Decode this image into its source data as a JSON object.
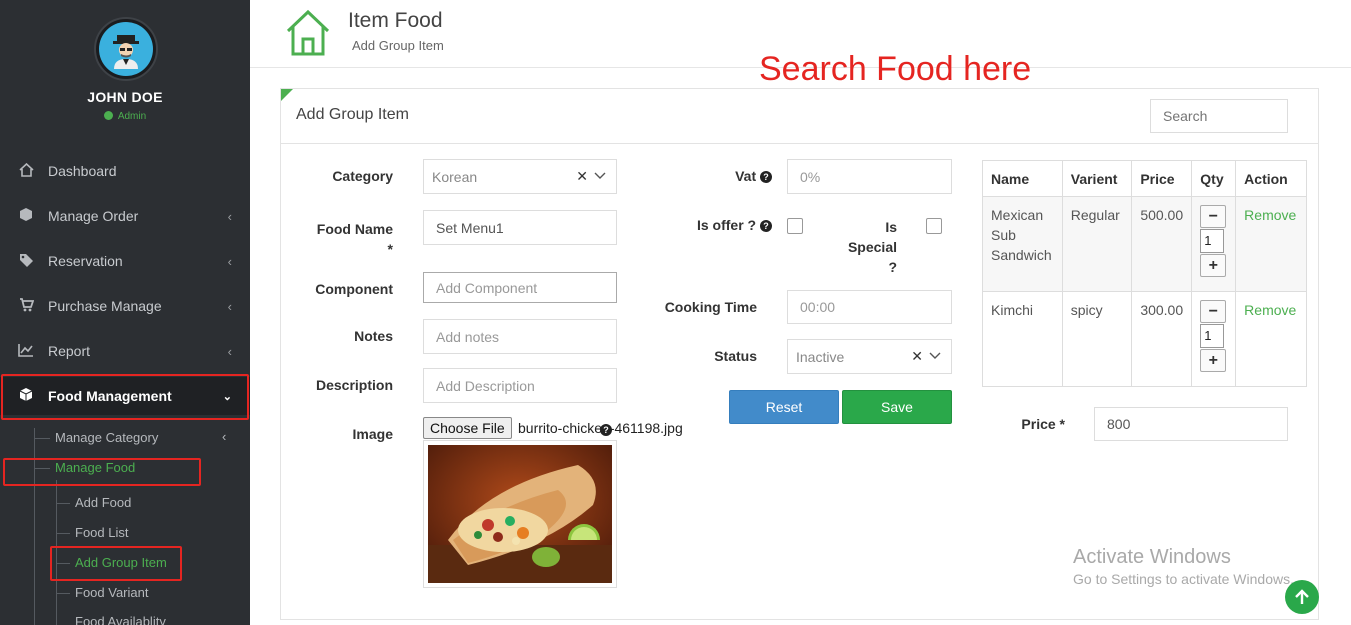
{
  "sidebar": {
    "user_name": "JOHN DOE",
    "user_role": "Admin",
    "menu": [
      {
        "label": "Dashboard",
        "icon": "home-icon"
      },
      {
        "label": "Manage Order",
        "icon": "cube-icon"
      },
      {
        "label": "Reservation",
        "icon": "tag-icon"
      },
      {
        "label": "Purchase Manage",
        "icon": "cart-icon"
      },
      {
        "label": "Report",
        "icon": "chart-icon"
      },
      {
        "label": "Food Management",
        "icon": "box-icon"
      }
    ],
    "submenu": {
      "manage_category": "Manage Category",
      "manage_food": "Manage Food",
      "add_food": "Add Food",
      "food_list": "Food List",
      "add_group_item": "Add Group Item",
      "food_variant": "Food Variant",
      "food_availability": "Food Availablity"
    }
  },
  "header": {
    "title": "Item Food",
    "subtitle": "Add Group Item"
  },
  "annotation": "Search Food here",
  "panel": {
    "title": "Add Group Item",
    "search_placeholder": "Search"
  },
  "form": {
    "category_label": "Category",
    "category_value": "Korean",
    "food_name_label": "Food Name",
    "food_name_required": "*",
    "food_name_value": "Set Menu1",
    "component_label": "Component",
    "component_placeholder": "Add Component",
    "notes_label": "Notes",
    "notes_placeholder": "Add notes",
    "description_label": "Description",
    "description_placeholder": "Add Description",
    "image_label": "Image",
    "choose_file": "Choose File",
    "file_name": "burrito-chicken-461198.jpg",
    "vat_label": "Vat",
    "vat_placeholder": "0%",
    "is_offer_label": "Is offer ?",
    "is_special_l1": "Is",
    "is_special_l2": "Special",
    "is_special_l3": "?",
    "cooking_time_label": "Cooking Time",
    "cooking_time_placeholder": "00:00",
    "status_label": "Status",
    "status_value": "Inactive",
    "reset_button": "Reset",
    "save_button": "Save",
    "price_label": "Price *",
    "price_value": "800"
  },
  "table": {
    "headers": [
      "Name",
      "Varient",
      "Price",
      "Qty",
      "Action"
    ],
    "rows": [
      {
        "name": "Mexican Sub Sandwich",
        "variant": "Regular",
        "price": "500.00",
        "qty": "1",
        "action": "Remove"
      },
      {
        "name": "Kimchi",
        "variant": "spicy",
        "price": "300.00",
        "qty": "1",
        "action": "Remove"
      }
    ]
  },
  "watermark": {
    "line1": "Activate Windows",
    "line2": "Go to Settings to activate Windows."
  },
  "colors": {
    "sidebar_bg": "#2c2f33",
    "accent_green": "#4caf50",
    "reset_blue": "#428bca",
    "save_green": "#2aa84a",
    "annotation_red": "#e52521"
  }
}
